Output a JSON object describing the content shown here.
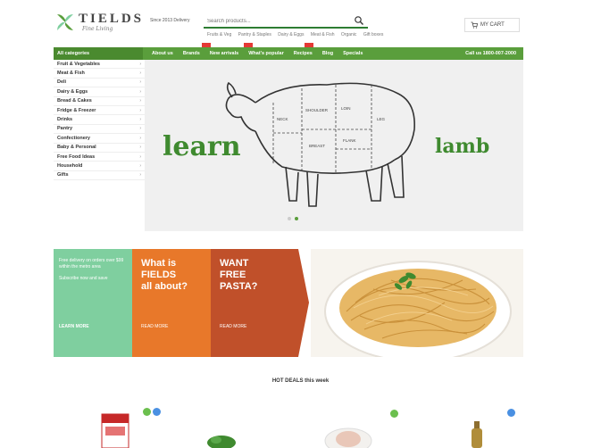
{
  "header": {
    "logo_name": "TIELDS",
    "logo_tagline": "Fine Living",
    "note": "Since 2013 Delivery",
    "search_placeholder": "Search products...",
    "quicklinks": [
      "Fruits & Veg",
      "Pantry & Staples",
      "Dairy & Eggs",
      "Meat & Fish",
      "Organic",
      "Gift boxes"
    ],
    "cart_label": "MY CART"
  },
  "nav": {
    "category_label": "All categories",
    "links": [
      "About us",
      "Brands",
      "New arrivals",
      "What's popular",
      "Recipes",
      "Blog",
      "Specials"
    ],
    "phone": "Call us 1800-007-2000"
  },
  "sidebar": {
    "items": [
      "Fruit & Vegetables",
      "Meat & Fish",
      "Deli",
      "Dairy & Eggs",
      "Bread & Cakes",
      "Fridge & Freezer",
      "Drinks",
      "Pantry",
      "Confectionery",
      "Baby & Personal",
      "Free Food Ideas",
      "Household",
      "Gifts"
    ]
  },
  "hero": {
    "left_text": "learn",
    "right_text": "lamb"
  },
  "promo": {
    "mint_text": "Free delivery on orders over $99 within the metro area",
    "mint_sub": "Subscribe now and save",
    "mint_more": "LEARN MORE",
    "card1_title": "What is\nFIELDS\nall about?",
    "card1_link": "READ MORE",
    "card2_title": "WANT\nFREE\nPASTA?",
    "card2_link": "READ MORE"
  },
  "section": {
    "title": "HOT DEALS this week"
  },
  "colors": {
    "brand_green": "#5a9e3c",
    "nav_dark": "#4a8a2f",
    "mint": "#7fcf9f",
    "orange": "#e8782a",
    "rust": "#c0502a",
    "badge_green": "#6bbf4e",
    "badge_blue": "#4a90e2"
  },
  "icons": [
    "leaf-logo-icon",
    "search-icon",
    "cart-icon",
    "chevron-right-icon"
  ]
}
